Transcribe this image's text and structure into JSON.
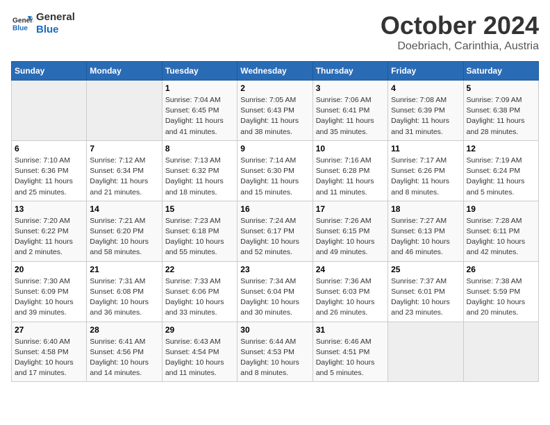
{
  "header": {
    "logo_line1": "General",
    "logo_line2": "Blue",
    "title": "October 2024",
    "subtitle": "Doebriach, Carinthia, Austria"
  },
  "days_of_week": [
    "Sunday",
    "Monday",
    "Tuesday",
    "Wednesday",
    "Thursday",
    "Friday",
    "Saturday"
  ],
  "weeks": [
    [
      {
        "num": "",
        "detail": ""
      },
      {
        "num": "",
        "detail": ""
      },
      {
        "num": "1",
        "detail": "Sunrise: 7:04 AM\nSunset: 6:45 PM\nDaylight: 11 hours and 41 minutes."
      },
      {
        "num": "2",
        "detail": "Sunrise: 7:05 AM\nSunset: 6:43 PM\nDaylight: 11 hours and 38 minutes."
      },
      {
        "num": "3",
        "detail": "Sunrise: 7:06 AM\nSunset: 6:41 PM\nDaylight: 11 hours and 35 minutes."
      },
      {
        "num": "4",
        "detail": "Sunrise: 7:08 AM\nSunset: 6:39 PM\nDaylight: 11 hours and 31 minutes."
      },
      {
        "num": "5",
        "detail": "Sunrise: 7:09 AM\nSunset: 6:38 PM\nDaylight: 11 hours and 28 minutes."
      }
    ],
    [
      {
        "num": "6",
        "detail": "Sunrise: 7:10 AM\nSunset: 6:36 PM\nDaylight: 11 hours and 25 minutes."
      },
      {
        "num": "7",
        "detail": "Sunrise: 7:12 AM\nSunset: 6:34 PM\nDaylight: 11 hours and 21 minutes."
      },
      {
        "num": "8",
        "detail": "Sunrise: 7:13 AM\nSunset: 6:32 PM\nDaylight: 11 hours and 18 minutes."
      },
      {
        "num": "9",
        "detail": "Sunrise: 7:14 AM\nSunset: 6:30 PM\nDaylight: 11 hours and 15 minutes."
      },
      {
        "num": "10",
        "detail": "Sunrise: 7:16 AM\nSunset: 6:28 PM\nDaylight: 11 hours and 11 minutes."
      },
      {
        "num": "11",
        "detail": "Sunrise: 7:17 AM\nSunset: 6:26 PM\nDaylight: 11 hours and 8 minutes."
      },
      {
        "num": "12",
        "detail": "Sunrise: 7:19 AM\nSunset: 6:24 PM\nDaylight: 11 hours and 5 minutes."
      }
    ],
    [
      {
        "num": "13",
        "detail": "Sunrise: 7:20 AM\nSunset: 6:22 PM\nDaylight: 11 hours and 2 minutes."
      },
      {
        "num": "14",
        "detail": "Sunrise: 7:21 AM\nSunset: 6:20 PM\nDaylight: 10 hours and 58 minutes."
      },
      {
        "num": "15",
        "detail": "Sunrise: 7:23 AM\nSunset: 6:18 PM\nDaylight: 10 hours and 55 minutes."
      },
      {
        "num": "16",
        "detail": "Sunrise: 7:24 AM\nSunset: 6:17 PM\nDaylight: 10 hours and 52 minutes."
      },
      {
        "num": "17",
        "detail": "Sunrise: 7:26 AM\nSunset: 6:15 PM\nDaylight: 10 hours and 49 minutes."
      },
      {
        "num": "18",
        "detail": "Sunrise: 7:27 AM\nSunset: 6:13 PM\nDaylight: 10 hours and 46 minutes."
      },
      {
        "num": "19",
        "detail": "Sunrise: 7:28 AM\nSunset: 6:11 PM\nDaylight: 10 hours and 42 minutes."
      }
    ],
    [
      {
        "num": "20",
        "detail": "Sunrise: 7:30 AM\nSunset: 6:09 PM\nDaylight: 10 hours and 39 minutes."
      },
      {
        "num": "21",
        "detail": "Sunrise: 7:31 AM\nSunset: 6:08 PM\nDaylight: 10 hours and 36 minutes."
      },
      {
        "num": "22",
        "detail": "Sunrise: 7:33 AM\nSunset: 6:06 PM\nDaylight: 10 hours and 33 minutes."
      },
      {
        "num": "23",
        "detail": "Sunrise: 7:34 AM\nSunset: 6:04 PM\nDaylight: 10 hours and 30 minutes."
      },
      {
        "num": "24",
        "detail": "Sunrise: 7:36 AM\nSunset: 6:03 PM\nDaylight: 10 hours and 26 minutes."
      },
      {
        "num": "25",
        "detail": "Sunrise: 7:37 AM\nSunset: 6:01 PM\nDaylight: 10 hours and 23 minutes."
      },
      {
        "num": "26",
        "detail": "Sunrise: 7:38 AM\nSunset: 5:59 PM\nDaylight: 10 hours and 20 minutes."
      }
    ],
    [
      {
        "num": "27",
        "detail": "Sunrise: 6:40 AM\nSunset: 4:58 PM\nDaylight: 10 hours and 17 minutes."
      },
      {
        "num": "28",
        "detail": "Sunrise: 6:41 AM\nSunset: 4:56 PM\nDaylight: 10 hours and 14 minutes."
      },
      {
        "num": "29",
        "detail": "Sunrise: 6:43 AM\nSunset: 4:54 PM\nDaylight: 10 hours and 11 minutes."
      },
      {
        "num": "30",
        "detail": "Sunrise: 6:44 AM\nSunset: 4:53 PM\nDaylight: 10 hours and 8 minutes."
      },
      {
        "num": "31",
        "detail": "Sunrise: 6:46 AM\nSunset: 4:51 PM\nDaylight: 10 hours and 5 minutes."
      },
      {
        "num": "",
        "detail": ""
      },
      {
        "num": "",
        "detail": ""
      }
    ]
  ]
}
